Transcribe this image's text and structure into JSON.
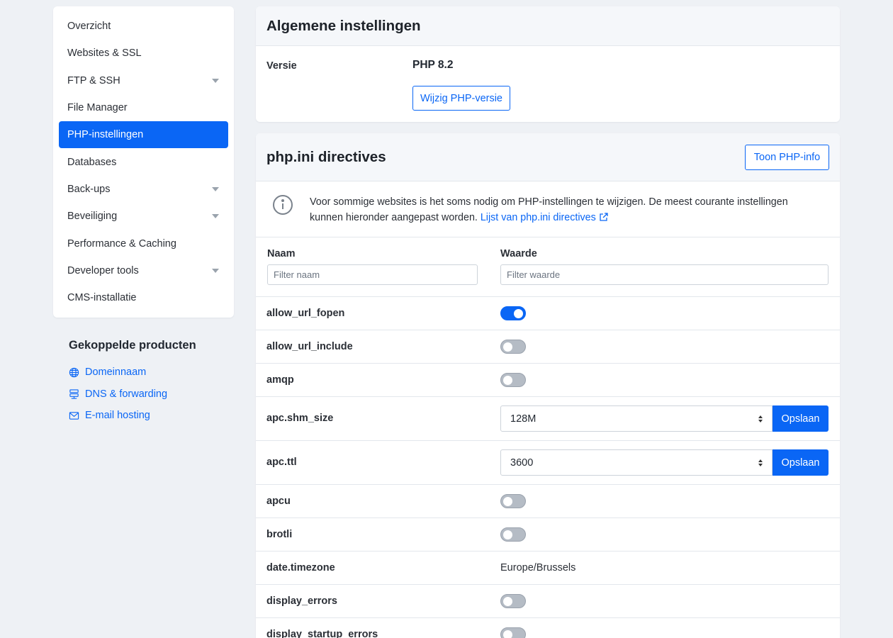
{
  "sidebar": {
    "items": [
      {
        "label": "Overzicht"
      },
      {
        "label": "Websites & SSL"
      },
      {
        "label": "FTP & SSH"
      },
      {
        "label": "File Manager"
      },
      {
        "label": "PHP-instellingen"
      },
      {
        "label": "Databases"
      },
      {
        "label": "Back-ups"
      },
      {
        "label": "Beveiliging"
      },
      {
        "label": "Performance & Caching"
      },
      {
        "label": "Developer tools"
      },
      {
        "label": "CMS-installatie"
      }
    ],
    "active": "PHP-instellingen"
  },
  "linked_products": {
    "title": "Gekoppelde producten",
    "items": [
      {
        "label": "Domeinnaam",
        "icon": "globe-icon"
      },
      {
        "label": "DNS & forwarding",
        "icon": "dns-icon"
      },
      {
        "label": "E-mail hosting",
        "icon": "mail-icon"
      }
    ]
  },
  "general": {
    "title": "Algemene instellingen",
    "version_label": "Versie",
    "version_value": "PHP 8.2",
    "change_button": "Wijzig PHP-versie"
  },
  "directives": {
    "title": "php.ini directives",
    "info_button": "Toon PHP-info",
    "info_text": "Voor sommige websites is het soms nodig om PHP-instellingen te wijzigen. De meest courante instellingen kunnen hieronder aangepast worden.",
    "info_link": "Lijst van php.ini directives",
    "col_name": "Naam",
    "col_value": "Waarde",
    "filter_name_placeholder": "Filter naam",
    "filter_value_placeholder": "Filter waarde",
    "save_label": "Opslaan",
    "rows": [
      {
        "name": "allow_url_fopen",
        "type": "toggle",
        "on": true
      },
      {
        "name": "allow_url_include",
        "type": "toggle",
        "on": false
      },
      {
        "name": "amqp",
        "type": "toggle",
        "on": false
      },
      {
        "name": "apc.shm_size",
        "type": "select",
        "value": "128M"
      },
      {
        "name": "apc.ttl",
        "type": "select",
        "value": "3600"
      },
      {
        "name": "apcu",
        "type": "toggle",
        "on": false
      },
      {
        "name": "brotli",
        "type": "toggle",
        "on": false
      },
      {
        "name": "date.timezone",
        "type": "text",
        "value": "Europe/Brussels"
      },
      {
        "name": "display_errors",
        "type": "toggle",
        "on": false
      },
      {
        "name": "display_startup_errors",
        "type": "toggle",
        "on": false
      }
    ]
  },
  "colors": {
    "accent": "#0a66f5",
    "background": "#eef1f5"
  }
}
